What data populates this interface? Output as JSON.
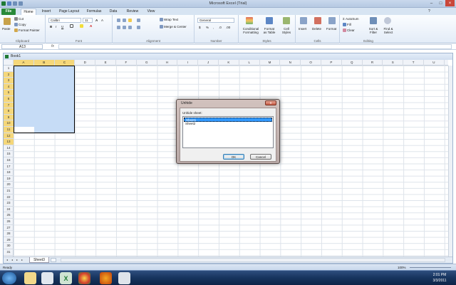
{
  "window": {
    "title": "Microsoft Excel (Trial)"
  },
  "ribbon": {
    "tabs": [
      "File",
      "Home",
      "Insert",
      "Page Layout",
      "Formulas",
      "Data",
      "Review",
      "View"
    ],
    "clipboard": {
      "paste": "Paste",
      "cut": "Cut",
      "copy": "Copy",
      "format_painter": "Format Painter",
      "label": "Clipboard"
    },
    "font": {
      "name": "Calibri",
      "size": "11",
      "label": "Font"
    },
    "alignment": {
      "wrap": "Wrap Text",
      "merge": "Merge & Center",
      "label": "Alignment"
    },
    "number": {
      "format": "General",
      "label": "Number"
    },
    "styles": {
      "cond": "Conditional Formatting",
      "table": "Format as Table",
      "cell": "Cell Styles",
      "label": "Styles"
    },
    "cells": {
      "insert": "Insert",
      "delete": "Delete",
      "format": "Format",
      "label": "Cells"
    },
    "editing": {
      "autosum": "AutoSum",
      "fill": "Fill",
      "clear": "Clear",
      "sort": "Sort & Filter",
      "find": "Find & Select",
      "label": "Editing"
    }
  },
  "formula_bar": {
    "name_box": "A13"
  },
  "workbook": {
    "title": "Book1",
    "columns": [
      "A",
      "B",
      "C",
      "D",
      "E",
      "F",
      "G",
      "H",
      "I",
      "J",
      "K",
      "L",
      "M",
      "N",
      "O",
      "P",
      "Q",
      "R",
      "S",
      "T",
      "U"
    ],
    "rows": [
      "1",
      "2",
      "3",
      "4",
      "5",
      "6",
      "7",
      "8",
      "9",
      "10",
      "11",
      "12",
      "13",
      "14",
      "15",
      "16",
      "17",
      "18",
      "19",
      "20",
      "21",
      "22",
      "23",
      "24",
      "25",
      "26",
      "27",
      "28",
      "29",
      "30",
      "31"
    ],
    "sheet_tab": "Sheet3"
  },
  "dialog": {
    "title": "Unhide",
    "close": "x",
    "label": "Unhide sheet:",
    "items": [
      "Sheet1",
      "Sheet2"
    ],
    "ok": "OK",
    "cancel": "Cancel"
  },
  "status": {
    "text": "Ready",
    "zoom": "100%"
  },
  "taskbar": {
    "time": "2:01 PM",
    "date": "3/3/2011"
  }
}
